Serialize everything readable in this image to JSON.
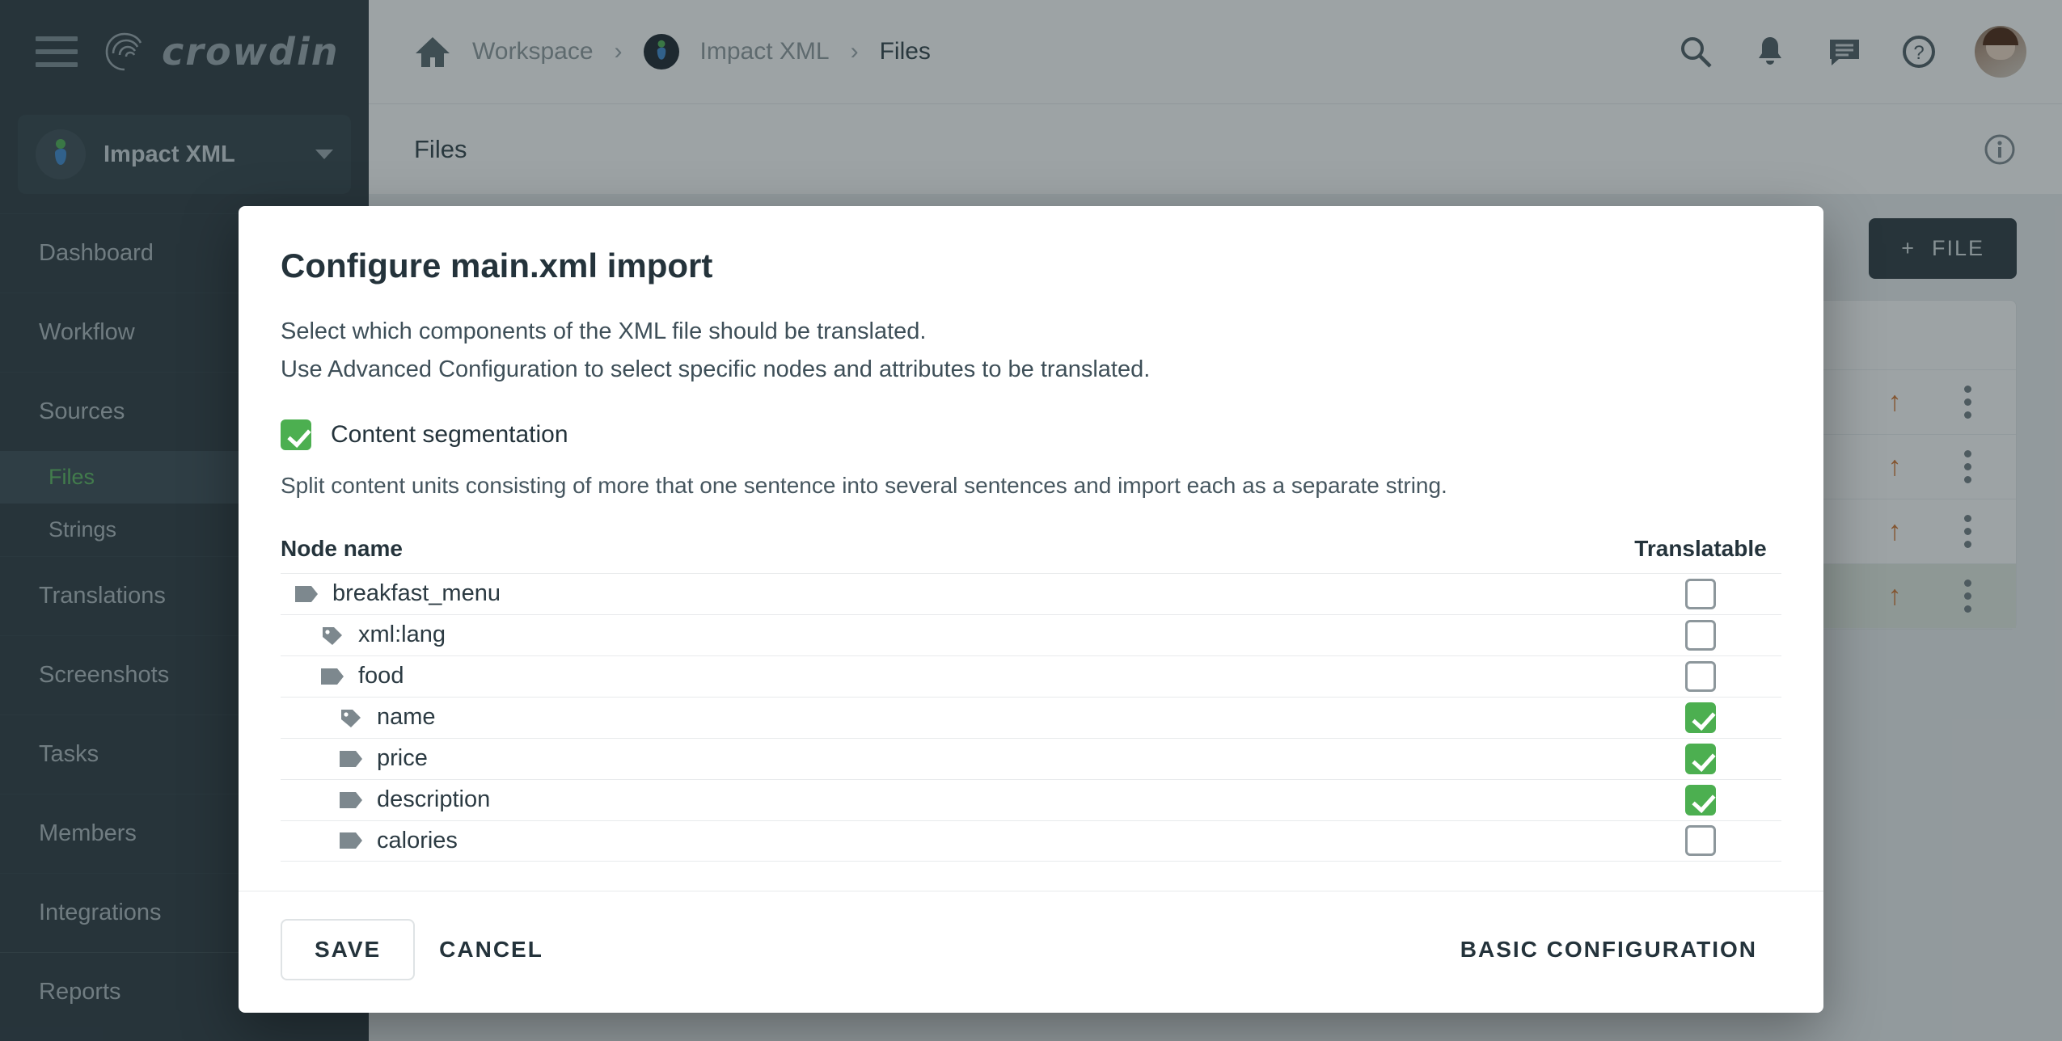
{
  "sidebar": {
    "logo_text": "crowdin",
    "hamburger_icon": "hamburger-menu-icon",
    "project": {
      "name": "Impact XML",
      "dropdown_icon": "chevron-down-icon"
    },
    "items": [
      {
        "label": "Dashboard",
        "type": "top",
        "active": false
      },
      {
        "label": "Workflow",
        "type": "top",
        "active": false
      },
      {
        "label": "Sources",
        "type": "top",
        "active": false
      },
      {
        "label": "Files",
        "type": "sub",
        "active": true
      },
      {
        "label": "Strings",
        "type": "sub",
        "active": false
      },
      {
        "label": "Translations",
        "type": "top",
        "active": false
      },
      {
        "label": "Screenshots",
        "type": "top",
        "active": false
      },
      {
        "label": "Tasks",
        "type": "top",
        "active": false
      },
      {
        "label": "Members",
        "type": "top",
        "active": false
      },
      {
        "label": "Integrations",
        "type": "top",
        "active": false
      },
      {
        "label": "Reports",
        "type": "top",
        "active": false,
        "chevron": "›"
      }
    ]
  },
  "topbar": {
    "home_icon": "home-icon",
    "breadcrumbs": [
      {
        "label": "Workspace",
        "current": false
      },
      {
        "label": "Impact XML",
        "current": false,
        "icon": "project-icon"
      },
      {
        "label": "Files",
        "current": true
      }
    ],
    "separator": "›",
    "icons": [
      {
        "name": "search-icon"
      },
      {
        "name": "bell-icon"
      },
      {
        "name": "chat-icon"
      },
      {
        "name": "help-icon"
      },
      {
        "name": "avatar"
      }
    ]
  },
  "page": {
    "title": "Files",
    "info_icon": "info-icon",
    "add_file_button": "FILE",
    "add_file_plus": "+",
    "rows": [
      {
        "selected": false
      },
      {
        "selected": false
      },
      {
        "selected": false
      },
      {
        "selected": true
      }
    ],
    "row_upload_icon": "up-arrow-icon",
    "row_menu_icon": "kebab-menu-icon"
  },
  "modal": {
    "title": "Configure main.xml import",
    "description_line1": "Select which components of the XML file should be translated.",
    "description_line2": "Use Advanced Configuration to select specific nodes and attributes to be translated.",
    "content_segmentation": {
      "label": "Content segmentation",
      "checked": true,
      "help": "Split content units consisting of more that one sentence into several sentences and import each as a separate string."
    },
    "table": {
      "columns": {
        "node_name": "Node name",
        "translatable": "Translatable"
      },
      "rows": [
        {
          "name": "breakfast_menu",
          "icon": "node-tag-icon",
          "kind": "node",
          "indent": 0,
          "translatable": false
        },
        {
          "name": "xml:lang",
          "icon": "attribute-tag-icon",
          "kind": "attr",
          "indent": 1,
          "translatable": false
        },
        {
          "name": "food",
          "icon": "node-tag-icon",
          "kind": "node",
          "indent": 1,
          "translatable": false
        },
        {
          "name": "name",
          "icon": "attribute-tag-icon",
          "kind": "attr",
          "indent": 2,
          "translatable": true
        },
        {
          "name": "price",
          "icon": "node-tag-icon",
          "kind": "node",
          "indent": 2,
          "translatable": true
        },
        {
          "name": "description",
          "icon": "node-tag-icon",
          "kind": "node",
          "indent": 2,
          "translatable": true
        },
        {
          "name": "calories",
          "icon": "node-tag-icon",
          "kind": "node",
          "indent": 2,
          "translatable": false
        }
      ]
    },
    "footer": {
      "save": "SAVE",
      "cancel": "CANCEL",
      "basic_configuration": "BASIC CONFIGURATION"
    }
  },
  "colors": {
    "sidebar_bg": "#28363d",
    "accent_green": "#4caf50",
    "active_link_green": "#59b85e",
    "upload_orange": "#d2722a",
    "selected_row": "#e3ece2"
  }
}
